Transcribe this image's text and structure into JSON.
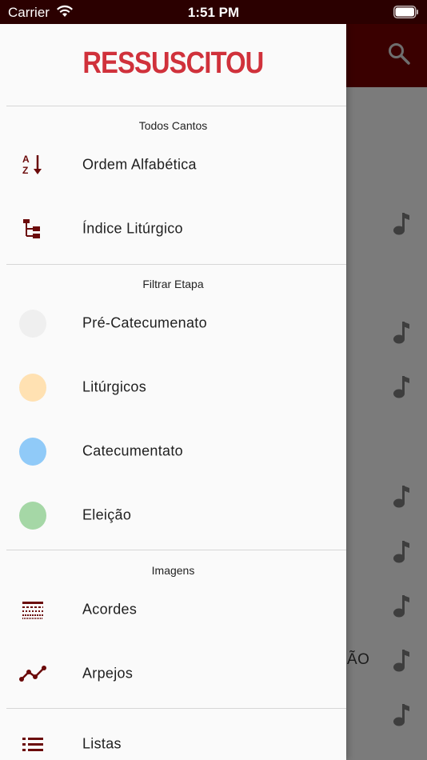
{
  "status_bar": {
    "carrier": "Carrier",
    "time": "1:51 PM"
  },
  "app": {
    "background_text": "ÃO"
  },
  "drawer": {
    "logo": "RESSUSCITOU",
    "sections": {
      "todos_cantos": "Todos Cantos",
      "filtrar_etapa": "Filtrar Etapa",
      "imagens": "Imagens"
    },
    "items": {
      "ordem": "Ordem Alfabética",
      "indice": "Índice Litúrgico",
      "pre": "Pré-Catecumenato",
      "liturgicos": "Litúrgicos",
      "catecumentato": "Catecumentato",
      "eleicao": "Eleição",
      "acordes": "Acordes",
      "arpejos": "Arpejos",
      "listas": "Listas"
    }
  },
  "colors": {
    "brand_dark": "#3a0000",
    "logo_red": "#d0313b",
    "icon_maroon": "#6b0a0a",
    "pre_catecumenato": "#efefef",
    "liturgicos": "#ffe1b2",
    "catecumentato": "#90caf8",
    "eleicao": "#a5d7a6"
  }
}
